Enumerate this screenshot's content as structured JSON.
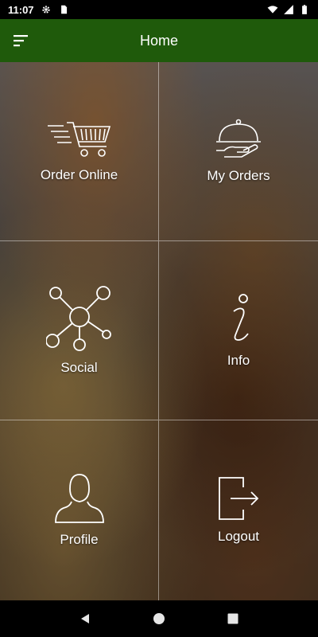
{
  "status_bar": {
    "time": "11:07",
    "icons": [
      "gear-icon",
      "sd-card-icon",
      "wifi-icon",
      "signal-icon",
      "battery-icon"
    ]
  },
  "app_bar": {
    "title": "Home",
    "menu_icon": "menu-icon",
    "color": "#1f5a0b"
  },
  "tiles": [
    {
      "label": "Order Online",
      "icon": "shopping-cart-icon"
    },
    {
      "label": "My Orders",
      "icon": "serving-cloche-icon"
    },
    {
      "label": "Social",
      "icon": "network-icon"
    },
    {
      "label": "Info",
      "icon": "info-icon"
    },
    {
      "label": "Profile",
      "icon": "person-icon"
    },
    {
      "label": "Logout",
      "icon": "logout-icon"
    }
  ],
  "nav_bar": {
    "icons": [
      "back-icon",
      "home-icon",
      "recents-icon"
    ]
  }
}
